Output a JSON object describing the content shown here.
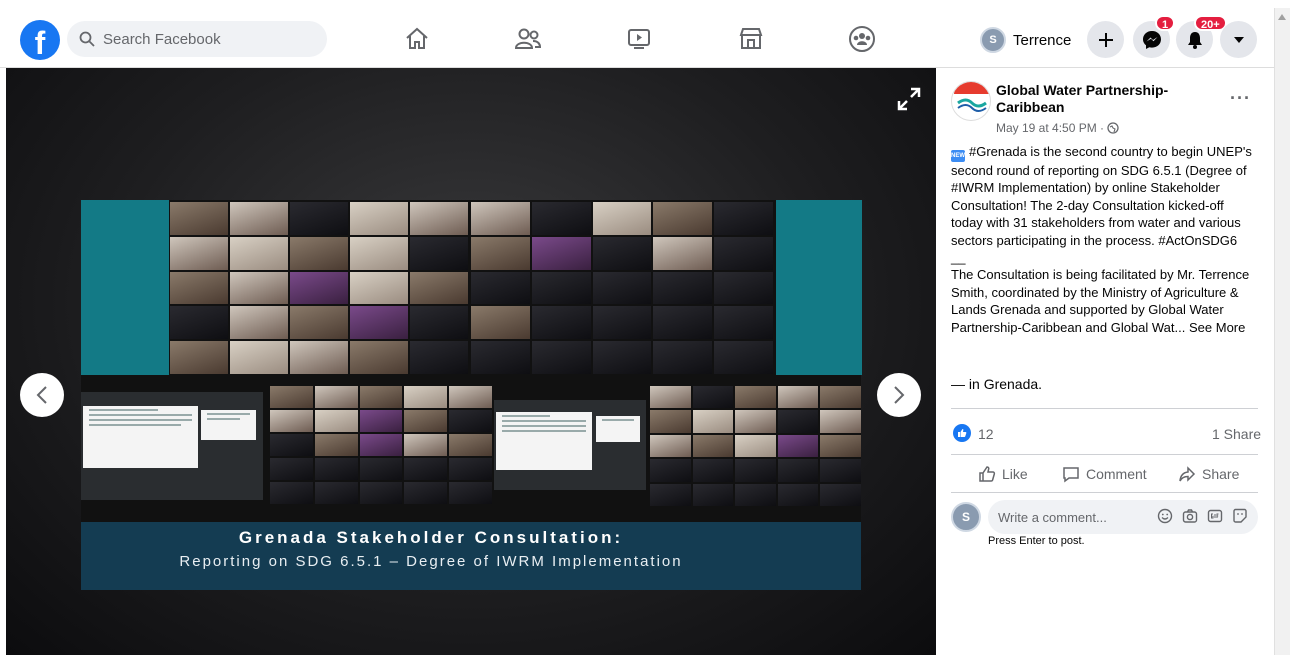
{
  "topbar": {
    "logo": "f",
    "search_placeholder": "Search Facebook",
    "nav_icons": [
      "home-icon",
      "friends-icon",
      "watch-icon",
      "marketplace-icon",
      "groups-icon"
    ],
    "profile_name": "Terrence",
    "messenger_badge": "1",
    "notifications_badge": "20+"
  },
  "viewer": {
    "banner_title": "Grenada Stakeholder Consultation:",
    "banner_subtitle": "Reporting on SDG 6.5.1 – Degree of IWRM Implementation"
  },
  "post": {
    "page_name": "Global Water Partnership-Caribbean",
    "time": "May 19 at 4:50 PM ·",
    "text_1": "#Grenada is the second country to begin UNEP's second round of reporting on SDG 6.5.1 (Degree of #IWRM Implementation) by online Stakeholder Consultation! The 2-day Consultation kicked-off today with 31 stakeholders from water and various sectors participating in the process. #ActOnSDG6",
    "separator": "__",
    "text_2": "The Consultation is being facilitated by Mr. Terrence Smith, coordinated by the Ministry of Agriculture & Lands Grenada and supported by Global Water Partnership-Caribbean and Global Wat...",
    "see_more": "See More",
    "location_prefix": "— in",
    "location": "Grenada.",
    "like_count": "12",
    "share_count": "1 Share",
    "actions": {
      "like": "Like",
      "comment": "Comment",
      "share": "Share"
    },
    "comment_placeholder": "Write a comment...",
    "press_enter": "Press Enter to post."
  },
  "colors": {
    "facebook_blue": "#1877f2",
    "badge_red": "#e41e3f",
    "slide_teal": "#137a86",
    "banner_navy": "#143c52"
  }
}
